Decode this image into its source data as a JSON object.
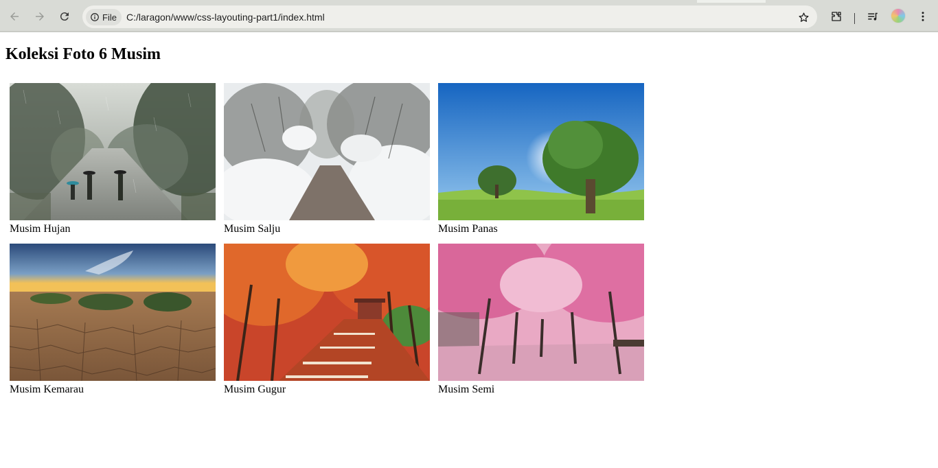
{
  "browser": {
    "chip_label": "File",
    "url": "C:/laragon/www/css-layouting-part1/index.html",
    "icons": [
      "arrow-left-icon",
      "arrow-right-icon",
      "reload-icon",
      "info-icon",
      "star-icon",
      "puzzle-icon",
      "media-queue-icon",
      "avatar",
      "kebab-menu-icon"
    ]
  },
  "page": {
    "title": "Koleksi Foto 6 Musim"
  },
  "gallery": {
    "items": [
      {
        "caption": "Musim Hujan"
      },
      {
        "caption": "Musim Salju"
      },
      {
        "caption": "Musim Panas"
      },
      {
        "caption": "Musim Kemarau"
      },
      {
        "caption": "Musim Gugur"
      },
      {
        "caption": "Musim Semi"
      }
    ]
  }
}
